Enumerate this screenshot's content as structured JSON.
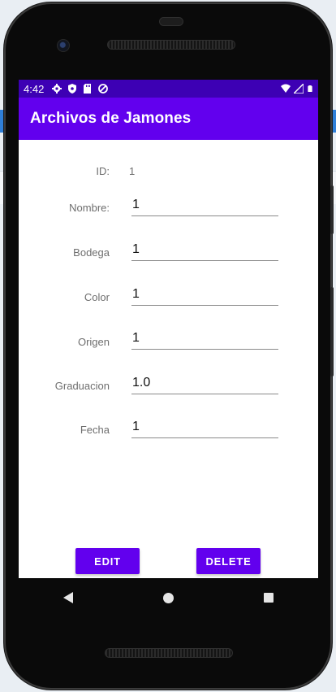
{
  "status_bar": {
    "time": "4:42",
    "left_icons": [
      "settings-icon",
      "shield-icon",
      "sd-card-icon",
      "sync-icon"
    ],
    "right_icons": [
      "wifi-icon",
      "signal-icon",
      "battery-icon"
    ]
  },
  "app_bar": {
    "title": "Archivos de Jamones"
  },
  "form": {
    "id": {
      "label": "ID:",
      "value": "1"
    },
    "nombre": {
      "label": "Nombre:",
      "value": "1"
    },
    "bodega": {
      "label": "Bodega",
      "value": "1"
    },
    "color": {
      "label": "Color",
      "value": "1"
    },
    "origen": {
      "label": "Origen",
      "value": "1"
    },
    "graduacion": {
      "label": "Graduacion",
      "value": "1.0"
    },
    "fecha": {
      "label": "Fecha",
      "value": "1"
    }
  },
  "buttons": {
    "edit": "EDIT",
    "delete": "DELETE"
  },
  "colors": {
    "primary": "#6200ee",
    "status_bar": "#3d00b4"
  },
  "nav_bar": [
    "back-icon",
    "home-icon",
    "recents-icon"
  ]
}
